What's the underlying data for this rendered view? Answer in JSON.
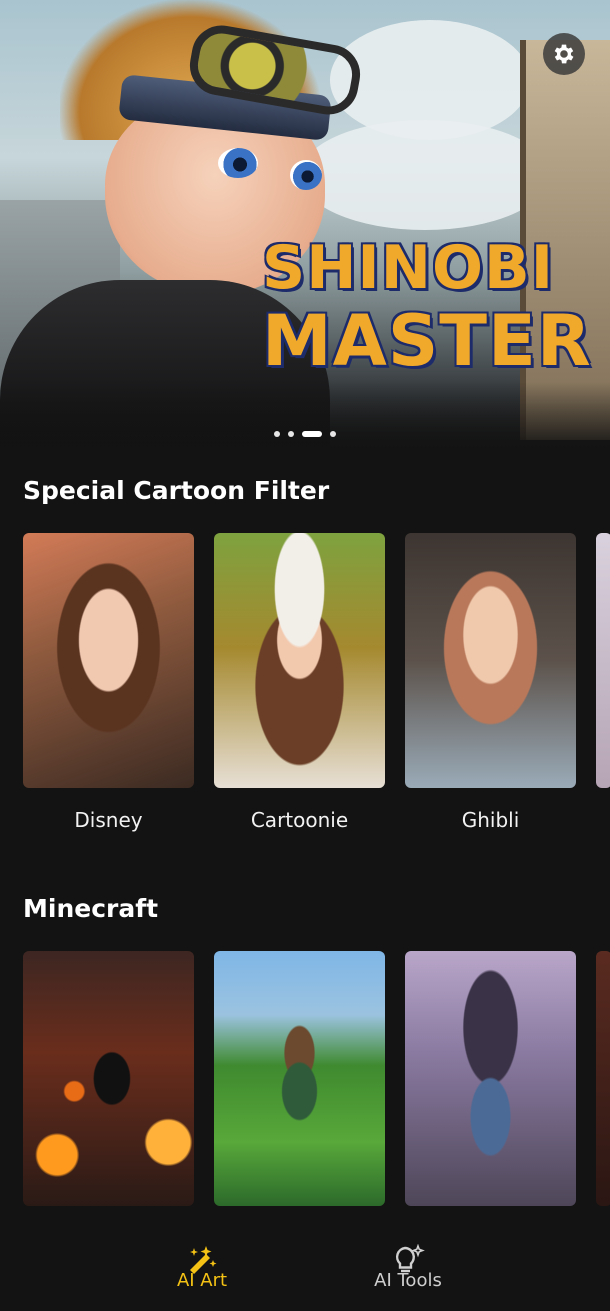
{
  "hero": {
    "title_line1": "SHINOBI",
    "title_line2": "MASTER",
    "carousel_total": 4,
    "carousel_active": 3
  },
  "sections": [
    {
      "title": "Special Cartoon Filter",
      "items": [
        {
          "label": "Disney"
        },
        {
          "label": "Cartoonie"
        },
        {
          "label": "Ghibli"
        }
      ]
    },
    {
      "title": "Minecraft",
      "items": []
    }
  ],
  "bottom_nav": {
    "ai_art_label": "AI Art",
    "ai_tools_label": "AI Tools",
    "active_color": "#f4c214"
  },
  "icons": {
    "settings": "gear-icon",
    "ai_art": "sparkle-icon",
    "ai_tools": "lightbulb-icon"
  }
}
